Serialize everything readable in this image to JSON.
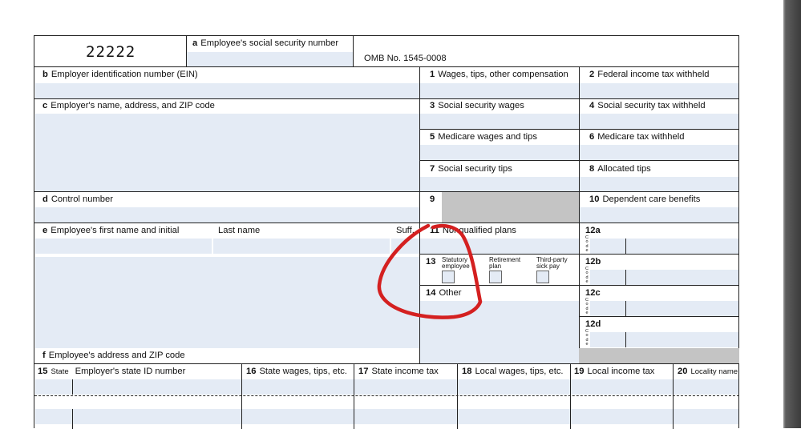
{
  "form_code": "22222",
  "box_a": {
    "letter": "a",
    "label": "Employee's social security number"
  },
  "omb": "OMB No. 1545-0008",
  "box_b": {
    "letter": "b",
    "label": "Employer identification number (EIN)"
  },
  "box_c": {
    "letter": "c",
    "label": "Employer's name, address, and ZIP code"
  },
  "box_d": {
    "letter": "d",
    "label": "Control number"
  },
  "box_e": {
    "letter": "e",
    "label": "Employee's first name and initial",
    "last": "Last name",
    "suff": "Suff."
  },
  "box_f": {
    "letter": "f",
    "label": "Employee's address and ZIP code"
  },
  "box1": {
    "num": "1",
    "label": "Wages, tips, other compensation"
  },
  "box2": {
    "num": "2",
    "label": "Federal income tax withheld"
  },
  "box3": {
    "num": "3",
    "label": "Social security wages"
  },
  "box4": {
    "num": "4",
    "label": "Social security tax withheld"
  },
  "box5": {
    "num": "5",
    "label": "Medicare wages and tips"
  },
  "box6": {
    "num": "6",
    "label": "Medicare tax withheld"
  },
  "box7": {
    "num": "7",
    "label": "Social security tips"
  },
  "box8": {
    "num": "8",
    "label": "Allocated tips"
  },
  "box9": {
    "num": "9"
  },
  "box10": {
    "num": "10",
    "label": "Dependent care benefits"
  },
  "box11": {
    "num": "11",
    "label": "Nonqualified plans"
  },
  "box12": {
    "labels": [
      "12a",
      "12b",
      "12c",
      "12d"
    ],
    "code_letters": [
      "C",
      "o",
      "d",
      "e"
    ]
  },
  "box13": {
    "num": "13",
    "statutory": [
      "Statutory",
      "employee"
    ],
    "retirement": [
      "Retirement",
      "plan"
    ],
    "thirdparty": [
      "Third-party",
      "sick pay"
    ]
  },
  "box14": {
    "num": "14",
    "label": "Other"
  },
  "box15": {
    "num": "15",
    "state": "State",
    "label": "Employer's state ID number"
  },
  "box16": {
    "num": "16",
    "label": "State wages, tips, etc."
  },
  "box17": {
    "num": "17",
    "label": "State income tax"
  },
  "box18": {
    "num": "18",
    "label": "Local wages, tips, etc."
  },
  "box19": {
    "num": "19",
    "label": "Local income tax"
  },
  "box20": {
    "num": "20",
    "label": "Locality name"
  },
  "annotation": {
    "color": "#d42020",
    "shape": "circle around box 13 and 14 labels"
  }
}
